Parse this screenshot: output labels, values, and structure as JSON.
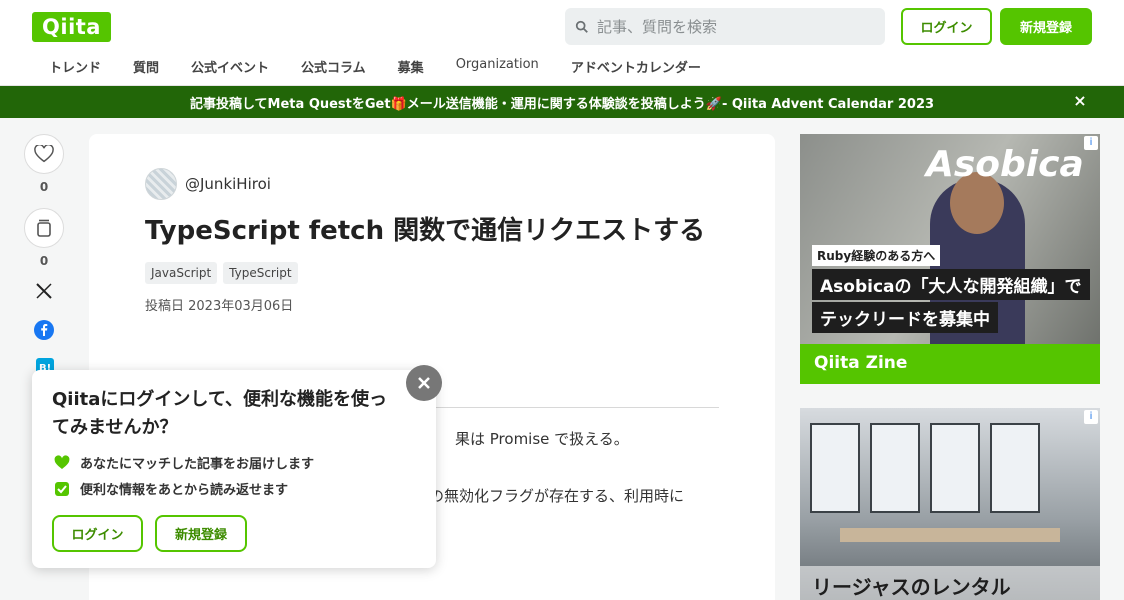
{
  "header": {
    "logo": "Qiita",
    "search_placeholder": "記事、質問を検索",
    "login_label": "ログイン",
    "signup_label": "新規登録",
    "nav": [
      "トレンド",
      "質問",
      "公式イベント",
      "公式コラム",
      "募集",
      "Organization",
      "アドベントカレンダー"
    ]
  },
  "banner": {
    "text": "記事投稿してMeta QuestをGet🎁メール送信機能・運用に関する体験談を投稿しよう🚀- Qiita Advent Calendar 2023",
    "close": "×"
  },
  "rail": {
    "like_count": "0",
    "stock_count": "0"
  },
  "article": {
    "author": "@JunkiHiroi",
    "title": "TypeScript fetch 関数で通信リクエストする",
    "tags": [
      "JavaScript",
      "TypeScript"
    ],
    "date": "投稿日 2023年03月06日",
    "line1": "果は Promise で扱える。",
    "line2": "の無効化フラグが存在する、利用時に"
  },
  "ads": {
    "ad1_logo": "Asobica",
    "ad1_chip": "Ruby経験のある方へ",
    "ad1_line1": "Asobicaの「大人な開発組織」で",
    "ad1_line2": "テックリードを募集中",
    "ad1_footer": "Qiita Zine",
    "ad2_text": "リージャスのレンタル",
    "info": "i"
  },
  "popup": {
    "title": "Qiitaにログインして、便利な機能を使ってみませんか？",
    "feature1": "あなたにマッチした記事をお届けします",
    "feature2": "便利な情報をあとから読み返せます",
    "login_label": "ログイン",
    "signup_label": "新規登録"
  },
  "colors": {
    "brand": "#55c500",
    "banner": "#226608"
  }
}
